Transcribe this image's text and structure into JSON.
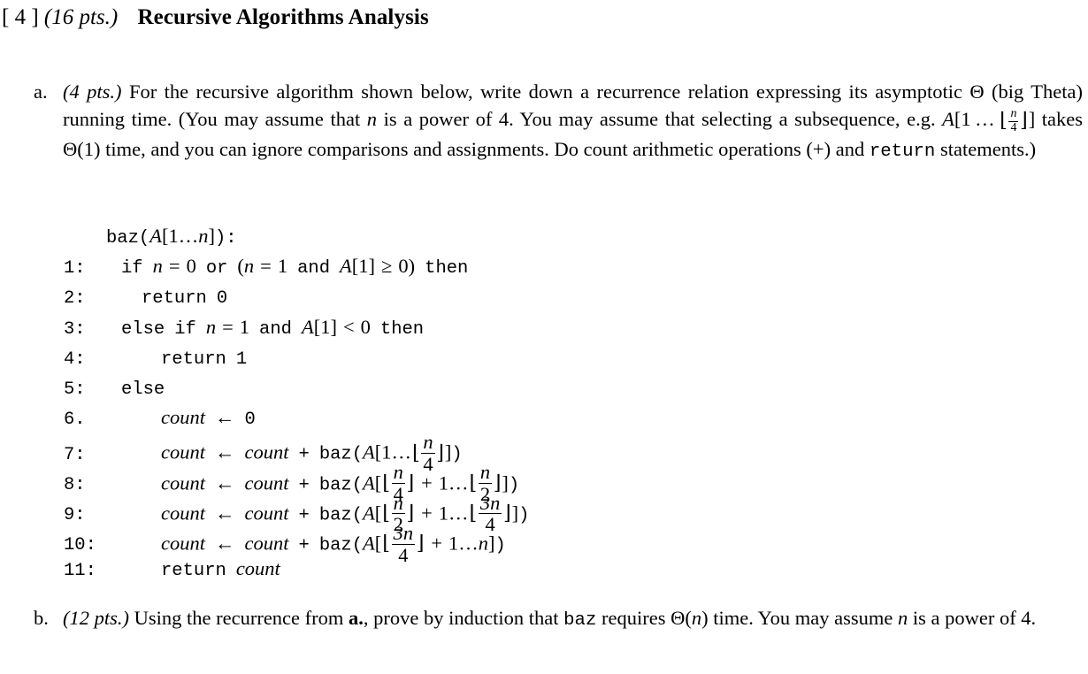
{
  "document": {
    "heading": {
      "question_number": "[ 4 ]",
      "points": "(16 pts.)",
      "title": "Recursive Algorithms Analysis"
    },
    "parts": [
      {
        "label": "a.",
        "points": "(4 pts.)",
        "text_segments": [
          "For the recursive algorithm shown below, write down a recurrence relation expressing its asymptotic Θ (big Theta) running time. (You may assume that ",
          "n",
          " is a power of 4. You may assume that selecting a subsequence, e.g. ",
          "A[1 … ⌊n/4⌋]",
          " takes Θ(1) time, and you can ignore comparisons and assignments. Do count arithmetic operations (+) and ",
          "return",
          " statements.)"
        ]
      },
      {
        "label": "b.",
        "points": "(12 pts.)",
        "text_segments": [
          "Using the recurrence from ",
          "a.",
          ", prove by induction that ",
          "baz",
          " requires Θ(",
          "n",
          ") time. You may assume ",
          "n",
          " is a power of 4."
        ]
      }
    ],
    "algorithm": {
      "signature": {
        "name": "baz",
        "open": "(",
        "array": "A",
        "bracket_open": "[",
        "first": "1",
        "dots": "…",
        "last": "n",
        "bracket_close": "]",
        "close": ")",
        "colon": ":"
      },
      "lines": [
        {
          "no": "1:",
          "indent": 1,
          "text": "if n = 0 or (n = 1 and A[1] ≥ 0) then"
        },
        {
          "no": "2:",
          "indent": 2,
          "text": "return 0"
        },
        {
          "no": "3:",
          "indent": 1,
          "text": "else if n = 1 and A[1] < 0 then"
        },
        {
          "no": "4:",
          "indent": 3,
          "text": "return 1"
        },
        {
          "no": "5:",
          "indent": 1,
          "text": "else"
        },
        {
          "no": "6.",
          "indent": 3,
          "text": "count ← 0"
        },
        {
          "no": "7:",
          "indent": 3,
          "text": "count ← count + baz(A[1 … ⌊n/4⌋])"
        },
        {
          "no": "8:",
          "indent": 3,
          "text": "count ← count + baz(A[⌊n/4⌋ + 1 … ⌊n/2⌋])"
        },
        {
          "no": "9:",
          "indent": 3,
          "text": "count ← count + baz(A[⌊n/2⌋ + 1 … ⌊3n/4⌋])"
        },
        {
          "no": "10:",
          "indent": 3,
          "text": "count ← count + baz(A[⌊3n/4⌋ + 1 … n])"
        },
        {
          "no": "11:",
          "indent": 3,
          "text": "return count"
        }
      ],
      "tokens": {
        "if": "if",
        "or": "or",
        "and": "and",
        "then": "then",
        "else": "else",
        "return": "return",
        "baz": "baz",
        "count": "count",
        "zero": "0",
        "one": "1",
        "eq": "=",
        "ge": "≥",
        "lt": "<",
        "plus": "+",
        "assign": "←",
        "dots": "…",
        "A": "A",
        "n": "n",
        "three_n": "3n",
        "four": "4",
        "two": "2",
        "lbrack": "[",
        "rbrack": "]",
        "lparen": "(",
        "rparen": ")"
      }
    },
    "colors": {
      "background": "#ffffff",
      "text": "#000000"
    }
  }
}
